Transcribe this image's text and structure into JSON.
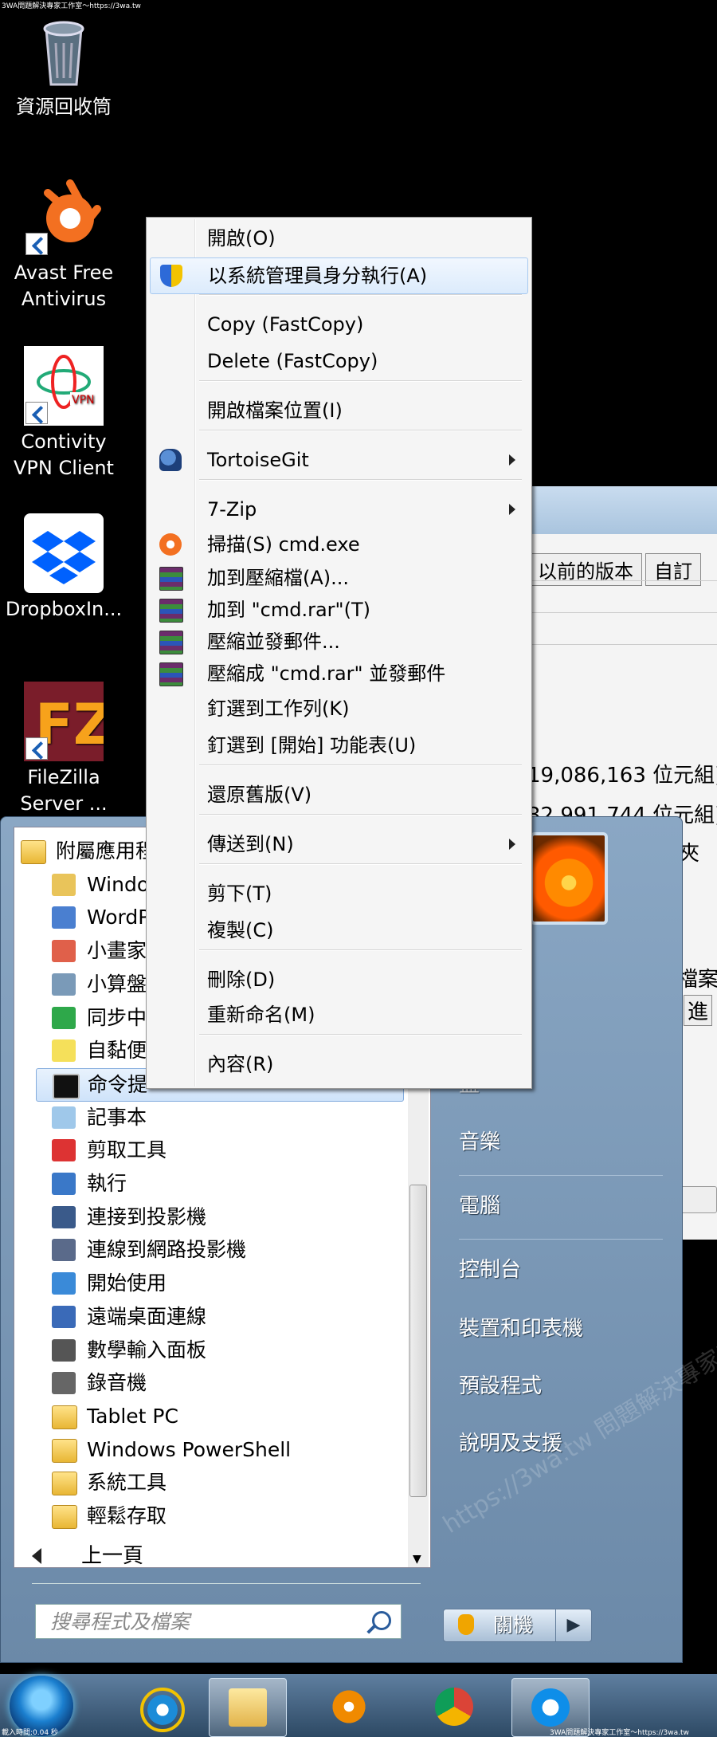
{
  "watermark": {
    "top": "3WA問題解決專家工作室～https://3wa.tw",
    "bottom_left": "載入時間:0.04 秒",
    "bottom_right": "3WA問題解決專家工作室～https://3wa.tw"
  },
  "desktop": {
    "icons": [
      {
        "name": "recycle-bin",
        "label": "資源回收筒"
      },
      {
        "name": "avast",
        "label": "Avast Free Antivirus"
      },
      {
        "name": "contivity",
        "label": "Contivity VPN Client"
      },
      {
        "name": "dropbox",
        "label": "DropboxIn..."
      },
      {
        "name": "filezilla",
        "label": "FileZilla Server ..."
      }
    ]
  },
  "background_window": {
    "tabs": [
      "以前的版本",
      "自訂"
    ],
    "size_text": "19,086,163 位元組)",
    "size_on_disk_text": "32,991,744 位元組)",
    "folder_fragment": "夾",
    "file_fragment": "檔案",
    "advanced_fragment": "進"
  },
  "context_menu": {
    "items": [
      {
        "label": "開啟(O)"
      },
      {
        "label": "以系統管理員身分執行(A)",
        "icon": "uac-shield-icon",
        "highlighted": true
      },
      {
        "label": "Copy  (FastCopy)"
      },
      {
        "label": "Delete (FastCopy)"
      },
      {
        "label": "開啟檔案位置(I)"
      },
      {
        "label": "TortoiseGit",
        "icon": "tortoisegit-icon",
        "submenu": true
      },
      {
        "label": "7-Zip",
        "submenu": true
      },
      {
        "label": "掃描(S) cmd.exe",
        "icon": "avast-icon"
      },
      {
        "label": "加到壓縮檔(A)...",
        "icon": "winrar-icon"
      },
      {
        "label": "加到 \"cmd.rar\"(T)",
        "icon": "winrar-icon"
      },
      {
        "label": "壓縮並發郵件...",
        "icon": "winrar-icon"
      },
      {
        "label": "壓縮成 \"cmd.rar\" 並發郵件",
        "icon": "winrar-icon"
      },
      {
        "label": "釘選到工作列(K)"
      },
      {
        "label": "釘選到 [開始] 功能表(U)"
      },
      {
        "label": "還原舊版(V)"
      },
      {
        "label": "傳送到(N)",
        "submenu": true
      },
      {
        "label": "剪下(T)"
      },
      {
        "label": "複製(C)"
      },
      {
        "label": "刪除(D)"
      },
      {
        "label": "重新命名(M)"
      },
      {
        "label": "內容(R)"
      }
    ]
  },
  "start_menu": {
    "programs": [
      {
        "label": "附屬應用程",
        "icon": "folder-icon",
        "folder": true
      },
      {
        "label": "Windo",
        "icon": "explorer-icon"
      },
      {
        "label": "WordP",
        "icon": "wordpad-icon"
      },
      {
        "label": "小畫家",
        "icon": "paint-icon"
      },
      {
        "label": "小算盤",
        "icon": "calculator-icon"
      },
      {
        "label": "同步中",
        "icon": "sync-center-icon"
      },
      {
        "label": "自黏便",
        "icon": "sticky-notes-icon"
      },
      {
        "label": "命令提",
        "icon": "cmd-icon",
        "selected": true
      },
      {
        "label": "記事本",
        "icon": "notepad-icon"
      },
      {
        "label": "剪取工具",
        "icon": "snipping-tool-icon"
      },
      {
        "label": "執行",
        "icon": "run-icon"
      },
      {
        "label": "連接到投影機",
        "icon": "projector-icon"
      },
      {
        "label": "連線到網路投影機",
        "icon": "network-projector-icon"
      },
      {
        "label": "開始使用",
        "icon": "getting-started-icon"
      },
      {
        "label": "遠端桌面連線",
        "icon": "remote-desktop-icon"
      },
      {
        "label": "數學輸入面板",
        "icon": "math-input-icon"
      },
      {
        "label": "錄音機",
        "icon": "sound-recorder-icon"
      },
      {
        "label": "Tablet PC",
        "icon": "folder-icon"
      },
      {
        "label": "Windows PowerShell",
        "icon": "folder-icon"
      },
      {
        "label": "系統工具",
        "icon": "folder-icon"
      },
      {
        "label": "輕鬆存取",
        "icon": "folder-icon"
      }
    ],
    "back_label": "上一頁",
    "search_placeholder": "搜尋程式及檔案",
    "right_items": [
      "音樂",
      "電腦",
      "控制台",
      "裝置和印表機",
      "預設程式",
      "說明及支援"
    ],
    "right_fragment": "盡",
    "shutdown_label": "關機",
    "watermark": "https://3wa.tw 問題解決專家工作室"
  },
  "taskbar": {
    "items": [
      "start-orb",
      "internet-explorer",
      "windows-explorer",
      "media-player",
      "chrome",
      "teamviewer"
    ]
  }
}
